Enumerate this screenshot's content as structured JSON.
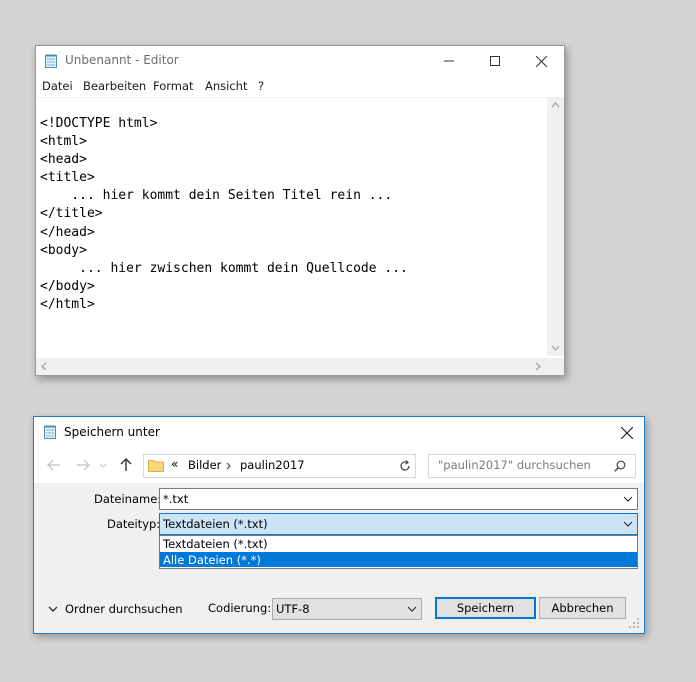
{
  "notepad": {
    "title": "Unbenannt - Editor",
    "menu": [
      "Datei",
      "Bearbeiten",
      "Format",
      "Ansicht",
      "?"
    ],
    "content": "<!DOCTYPE html>\n<html>\n<head>\n<title>\n    ... hier kommt dein Seiten Titel rein ...\n</title>\n</head>\n<body>\n     ... hier zwischen kommt dein Quellcode ...\n</body>\n</html>"
  },
  "save_dialog": {
    "title": "Speichern unter",
    "breadcrumb": {
      "overflow": "«",
      "items": [
        "Bilder",
        "paulin2017"
      ]
    },
    "search_placeholder": "\"paulin2017\" durchsuchen",
    "filename_label": "Dateiname:",
    "filename_value": "*.txt",
    "filetype_label": "Dateityp:",
    "filetype_value": "Textdateien (*.txt)",
    "filetype_options": [
      "Textdateien (*.txt)",
      "Alle Dateien  (*.*)"
    ],
    "filetype_selected_index": 1,
    "browse_folders_label": "Ordner durchsuchen",
    "encoding_label": "Codierung:",
    "encoding_value": "UTF-8",
    "save_button": "Speichern",
    "cancel_button": "Abbrechen"
  },
  "colors": {
    "desktop": "#d4d4d4",
    "accent": "#0078d7",
    "selection_bg": "#cce4f7"
  }
}
